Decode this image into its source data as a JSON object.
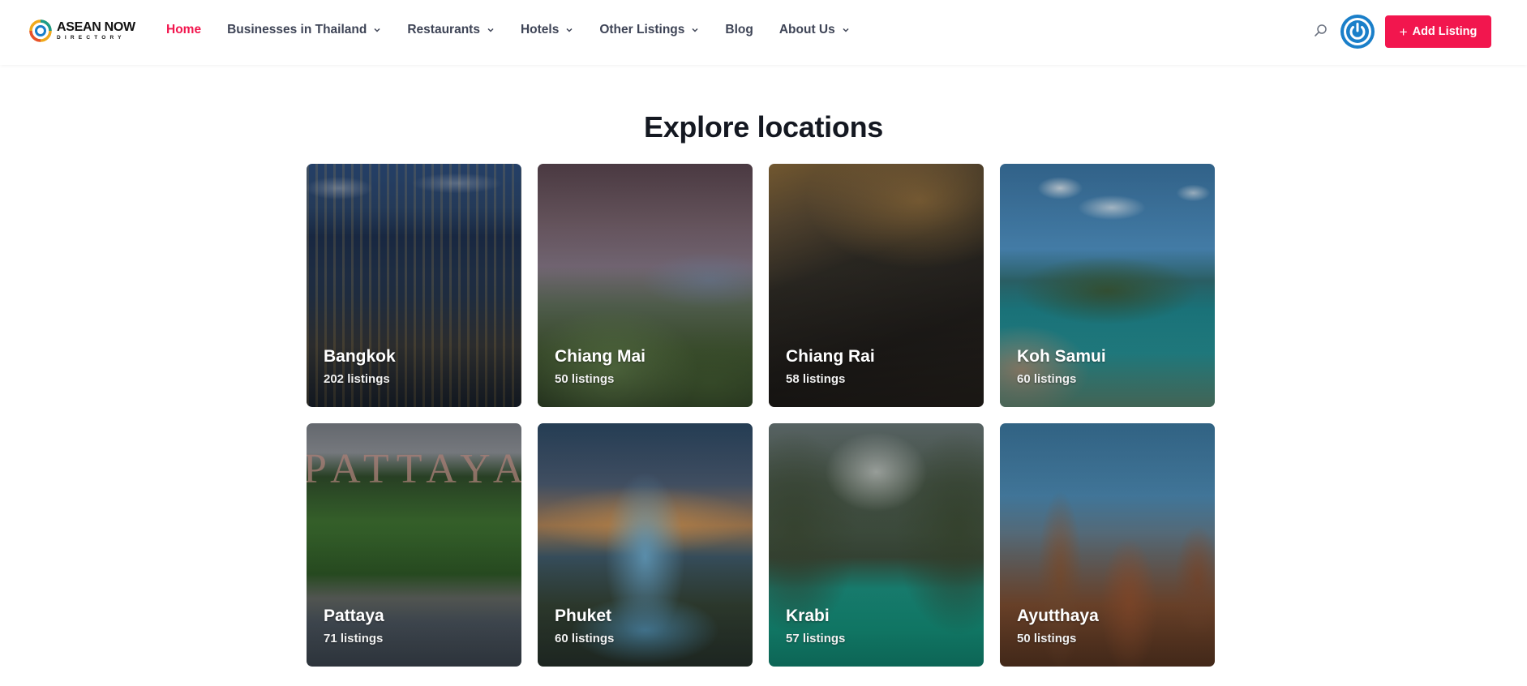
{
  "header": {
    "logo": {
      "line1": "ASEAN NOW",
      "line2": "DIRECTORY"
    },
    "nav": [
      {
        "label": "Home",
        "active": true,
        "dropdown": false
      },
      {
        "label": "Businesses in Thailand",
        "active": false,
        "dropdown": true
      },
      {
        "label": "Restaurants",
        "active": false,
        "dropdown": true
      },
      {
        "label": "Hotels",
        "active": false,
        "dropdown": true
      },
      {
        "label": "Other Listings",
        "active": false,
        "dropdown": true
      },
      {
        "label": "Blog",
        "active": false,
        "dropdown": false
      },
      {
        "label": "About Us",
        "active": false,
        "dropdown": true
      }
    ],
    "search_icon": "search-icon",
    "avatar_icon": "power-icon",
    "add_listing": {
      "icon": "plus-icon",
      "label": "Add Listing"
    }
  },
  "section": {
    "title": "Explore locations"
  },
  "locations": [
    {
      "name": "Bangkok",
      "count": "202 listings",
      "scene": "bangkok"
    },
    {
      "name": "Chiang Mai",
      "count": "50 listings",
      "scene": "chiangmai"
    },
    {
      "name": "Chiang Rai",
      "count": "58 listings",
      "scene": "chiangrai"
    },
    {
      "name": "Koh Samui",
      "count": "60 listings",
      "scene": "kohsamui"
    },
    {
      "name": "Pattaya",
      "count": "71 listings",
      "scene": "pattaya"
    },
    {
      "name": "Phuket",
      "count": "60 listings",
      "scene": "phuket"
    },
    {
      "name": "Krabi",
      "count": "57 listings",
      "scene": "krabi"
    },
    {
      "name": "Ayutthaya",
      "count": "50 listings",
      "scene": "ayutthaya"
    }
  ],
  "colors": {
    "accent": "#f2164e",
    "nav_text": "#3e4456",
    "avatar": "#1a7fc9",
    "title": "#141821"
  }
}
